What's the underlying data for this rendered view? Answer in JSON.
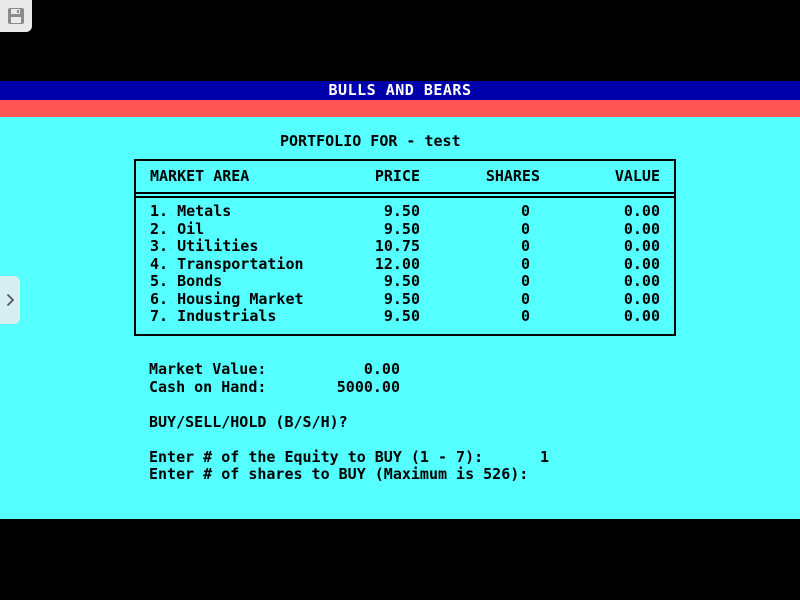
{
  "app": {
    "title": "BULLS AND BEARS"
  },
  "toolbar": {
    "save_icon": "floppy-disk-icon",
    "sidebar_toggle_icon": "chevron-right-icon"
  },
  "colors": {
    "background": "#000000",
    "title_bar": "#0000aa",
    "title_text": "#ffffff",
    "accent_stripe": "#ff5555",
    "screen": "#55ffff",
    "text": "#000000"
  },
  "portfolio": {
    "heading": "PORTFOLIO FOR - test",
    "columns": [
      "MARKET AREA",
      "PRICE",
      "SHARES",
      "VALUE"
    ],
    "rows": [
      {
        "name": "1. Metals",
        "price": "9.50",
        "shares": "0",
        "value": "0.00"
      },
      {
        "name": "2. Oil",
        "price": "9.50",
        "shares": "0",
        "value": "0.00"
      },
      {
        "name": "3. Utilities",
        "price": "10.75",
        "shares": "0",
        "value": "0.00"
      },
      {
        "name": "4. Transportation",
        "price": "12.00",
        "shares": "0",
        "value": "0.00"
      },
      {
        "name": "5. Bonds",
        "price": "9.50",
        "shares": "0",
        "value": "0.00"
      },
      {
        "name": "6. Housing Market",
        "price": "9.50",
        "shares": "0",
        "value": "0.00"
      },
      {
        "name": "7. Industrials",
        "price": "9.50",
        "shares": "0",
        "value": "0.00"
      }
    ]
  },
  "summary": {
    "market_value_label": "Market Value:",
    "market_value": "0.00",
    "cash_label": "Cash on Hand:",
    "cash_value": "5000.00"
  },
  "prompts": {
    "action": "BUY/SELL/HOLD (B/S/H)?",
    "equity_prompt": "Enter # of the Equity to BUY (1 - 7):",
    "equity_answer": "1",
    "shares_prompt": "Enter # of shares to BUY (Maximum is 526):"
  }
}
